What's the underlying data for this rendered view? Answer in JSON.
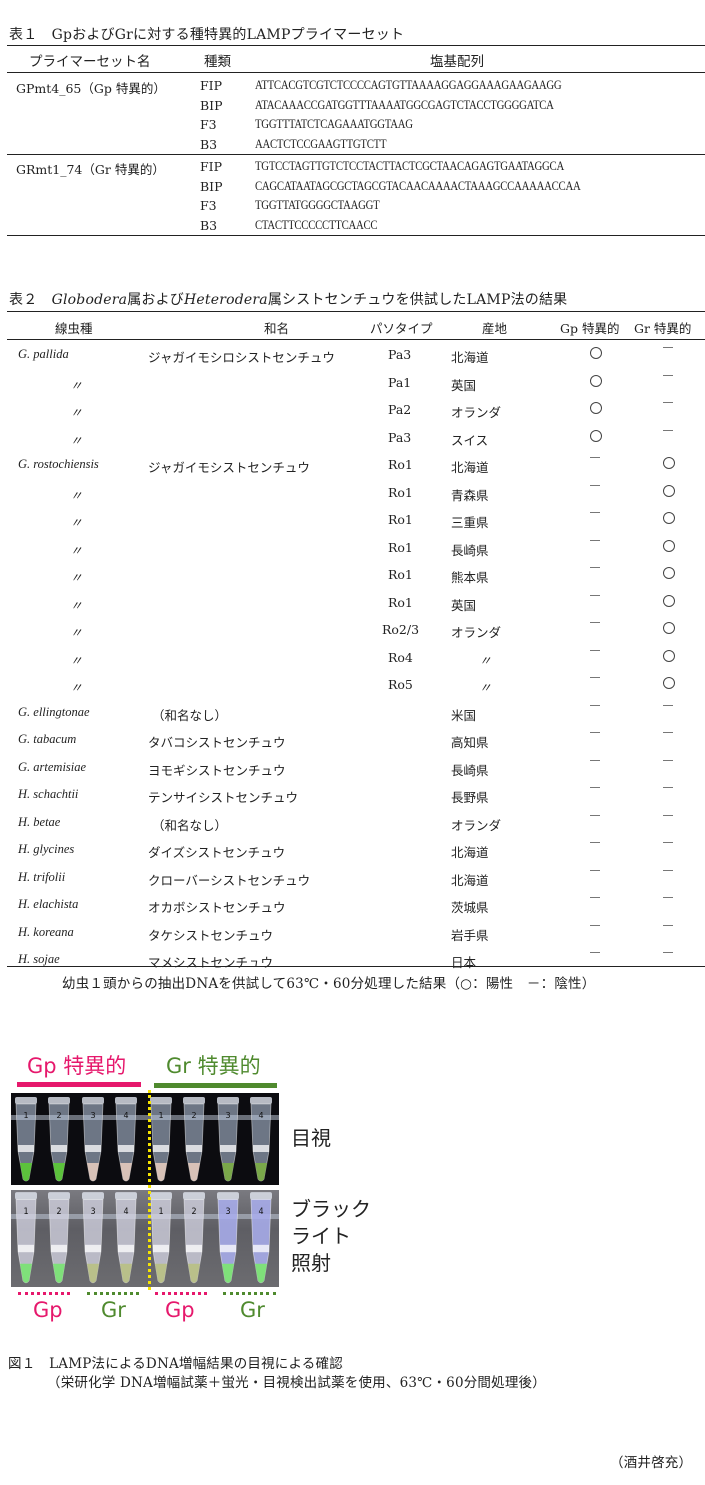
{
  "table1": {
    "caption": "表１　GpおよびGrに対する種特異的LAMPプライマーセット",
    "headers": {
      "name": "プライマーセット名",
      "type": "種類",
      "sequence": "塩基配列"
    },
    "groups": [
      {
        "name": "GPmt4_65（Gp 特異的）",
        "primers": [
          {
            "type": "FIP",
            "seq": "ATTCACGTCGTCTCCCCAGTGTTAAAAGGAGGAAAGAAGAAGG"
          },
          {
            "type": "BIP",
            "seq": "ATACAAACCGATGGTTTAAAATGGCGAGTCTACCTGGGGATCA"
          },
          {
            "type": "F3",
            "seq": "TGGTTTATCTCAGAAATGGTAAG"
          },
          {
            "type": "B3",
            "seq": "AACTCTCCGAAGTTGTCTT"
          }
        ]
      },
      {
        "name": "GRmt1_74（Gr 特異的）",
        "primers": [
          {
            "type": "FIP",
            "seq": "TGTCCTAGTTGTCTCCTACTTACTCGCTAACAGAGTGAATAGGCA"
          },
          {
            "type": "BIP",
            "seq": "CAGCATAATAGCGCTAGCGTACAACAAAACTAAAGCCAAAAACCAA"
          },
          {
            "type": "F3",
            "seq": "TGGTTATGGGGCTAAGGT"
          },
          {
            "type": "B3",
            "seq": "CTACTTCCCCCTTCAACC"
          }
        ]
      }
    ]
  },
  "table2": {
    "caption_prefix": "表２　",
    "caption_genus1": "Globodera",
    "caption_mid": "属および",
    "caption_genus2": "Heterodera",
    "caption_suffix": "属シストセンチュウを供試したLAMP法の結果",
    "headers": {
      "species": "線虫種",
      "japanese_name": "和名",
      "pathotype": "パソタイプ",
      "origin": "産地",
      "gp": "Gp 特異的",
      "gr": "Gr 特異的"
    },
    "rows": [
      {
        "species": "G.  pallida",
        "ja": "ジャガイモシロシストセンチュウ",
        "path": "Pa3",
        "origin": "北海道",
        "gp": "+",
        "gr": "-"
      },
      {
        "species": "〃",
        "ja": "",
        "path": "Pa1",
        "origin": "英国",
        "gp": "+",
        "gr": "-"
      },
      {
        "species": "〃",
        "ja": "",
        "path": "Pa2",
        "origin": "オランダ",
        "gp": "+",
        "gr": "-"
      },
      {
        "species": "〃",
        "ja": "",
        "path": "Pa3",
        "origin": "スイス",
        "gp": "+",
        "gr": "-"
      },
      {
        "species": "G.  rostochiensis",
        "ja": "ジャガイモシストセンチュウ",
        "path": "Ro1",
        "origin": "北海道",
        "gp": "-",
        "gr": "+"
      },
      {
        "species": "〃",
        "ja": "",
        "path": "Ro1",
        "origin": "青森県",
        "gp": "-",
        "gr": "+"
      },
      {
        "species": "〃",
        "ja": "",
        "path": "Ro1",
        "origin": "三重県",
        "gp": "-",
        "gr": "+"
      },
      {
        "species": "〃",
        "ja": "",
        "path": "Ro1",
        "origin": "長崎県",
        "gp": "-",
        "gr": "+"
      },
      {
        "species": "〃",
        "ja": "",
        "path": "Ro1",
        "origin": "熊本県",
        "gp": "-",
        "gr": "+"
      },
      {
        "species": "〃",
        "ja": "",
        "path": "Ro1",
        "origin": "英国",
        "gp": "-",
        "gr": "+"
      },
      {
        "species": "〃",
        "ja": "",
        "path": "Ro2/3",
        "origin": "オランダ",
        "gp": "-",
        "gr": "+"
      },
      {
        "species": "〃",
        "ja": "",
        "path": "Ro4",
        "origin": "〃",
        "gp": "-",
        "gr": "+"
      },
      {
        "species": "〃",
        "ja": "",
        "path": "Ro5",
        "origin": "〃",
        "gp": "-",
        "gr": "+"
      },
      {
        "species": "G.  ellingtonae",
        "ja": "（和名なし）",
        "path": "",
        "origin": "米国",
        "gp": "-",
        "gr": "-"
      },
      {
        "species": "G.  tabacum",
        "ja": "タバコシストセンチュウ",
        "path": "",
        "origin": "高知県",
        "gp": "-",
        "gr": "-"
      },
      {
        "species": "G.  artemisiae",
        "ja": "ヨモギシストセンチュウ",
        "path": "",
        "origin": "長崎県",
        "gp": "-",
        "gr": "-"
      },
      {
        "species": "H.  schachtii",
        "ja": "テンサイシストセンチュウ",
        "path": "",
        "origin": "長野県",
        "gp": "-",
        "gr": "-"
      },
      {
        "species": "H.  betae",
        "ja": "（和名なし）",
        "path": "",
        "origin": "オランダ",
        "gp": "-",
        "gr": "-"
      },
      {
        "species": "H.  glycines",
        "ja": "ダイズシストセンチュウ",
        "path": "",
        "origin": "北海道",
        "gp": "-",
        "gr": "-"
      },
      {
        "species": "H.  trifolii",
        "ja": "クローバーシストセンチュウ",
        "path": "",
        "origin": "北海道",
        "gp": "-",
        "gr": "-"
      },
      {
        "species": "H.  elachista",
        "ja": "オカボシストセンチュウ",
        "path": "",
        "origin": "茨城県",
        "gp": "-",
        "gr": "-"
      },
      {
        "species": "H.  koreana",
        "ja": "タケシストセンチュウ",
        "path": "",
        "origin": "岩手県",
        "gp": "-",
        "gr": "-"
      },
      {
        "species": "H.  sojae",
        "ja": "マメシストセンチュウ",
        "path": "",
        "origin": "日本",
        "gp": "-",
        "gr": "-"
      }
    ],
    "footnote": "幼虫１頭からの抽出DNAを供試して63℃・60分処理した結果（○：陽性　－：陰性）"
  },
  "figure1": {
    "top_labels": {
      "gp": "Gp 特異的",
      "gr": "Gr 特異的"
    },
    "side_labels": {
      "visual": "目視",
      "blacklight_line1": "ブラック",
      "blacklight_line2": "ライト",
      "blacklight_line3": "照射"
    },
    "bottom_labels": [
      "Gp",
      "Gr",
      "Gp",
      "Gr"
    ],
    "tube_numbers": [
      "1",
      "2",
      "3",
      "4",
      "1",
      "2",
      "3",
      "4"
    ],
    "tube_results": [
      "positive",
      "positive",
      "negative",
      "negative",
      "negative",
      "negative",
      "positive",
      "positive"
    ],
    "colors": {
      "gp": "#e6186c",
      "gr": "#4f8a2e",
      "positive_liquid": "#5cc23c",
      "negative_liquid": "#d8c2b8",
      "divider": "#f5e400"
    },
    "caption_line1": "図１　LAMP法によるDNA増幅結果の目視による確認",
    "caption_line2": "（栄研化学 DNA増幅試薬＋蛍光・目視検出試薬を使用、63℃・60分間処理後）"
  },
  "author": "（酒井啓充）"
}
